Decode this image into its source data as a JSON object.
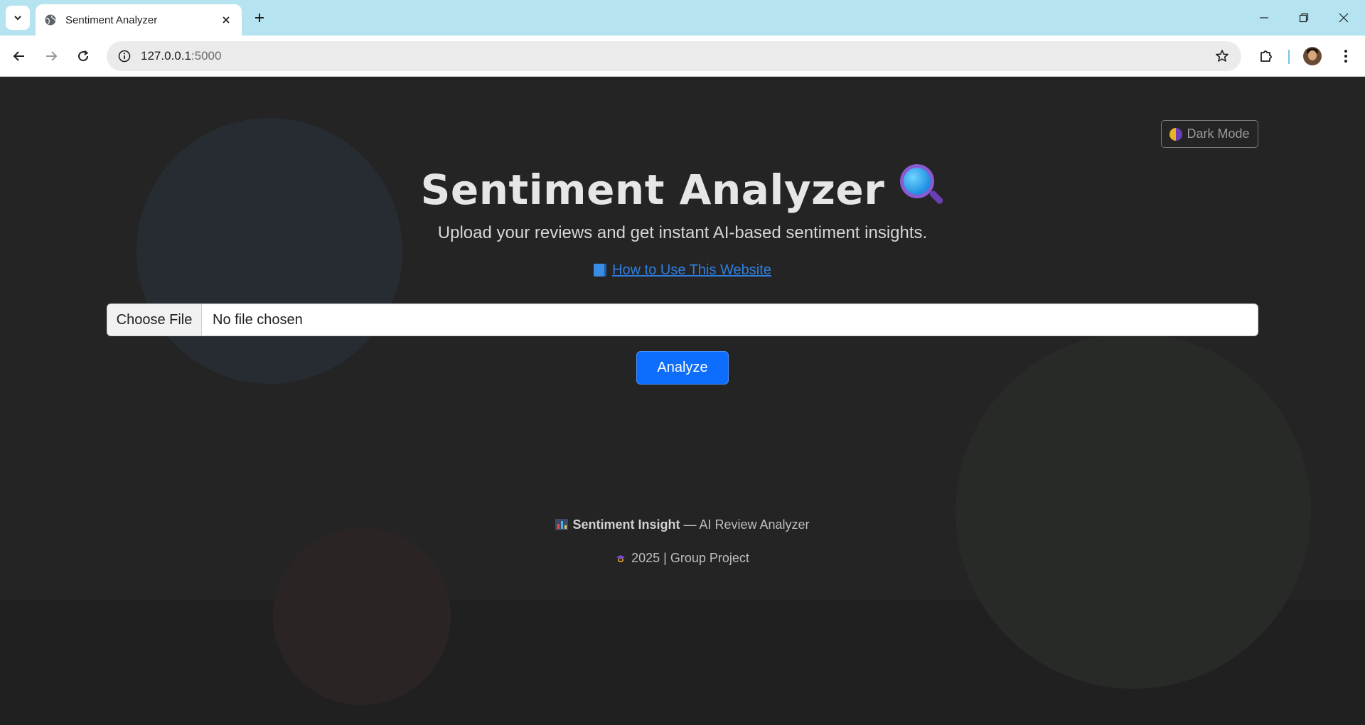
{
  "browser": {
    "tab_title": "Sentiment Analyzer",
    "url_host": "127.0.0.1",
    "url_port": ":5000"
  },
  "page": {
    "theme_toggle_label": "Dark Mode",
    "title": "Sentiment Analyzer",
    "subtitle": "Upload your reviews and get instant AI-based sentiment insights.",
    "how_to_link": "How to Use This Website",
    "file_input": {
      "button_label": "Choose File",
      "status": "No file chosen"
    },
    "analyze_button": "Analyze",
    "footer": {
      "brand": "Sentiment Insight",
      "tagline": "— AI Review Analyzer",
      "credit": "2025 | Group Project"
    },
    "colors": {
      "primary": "#0d6efd",
      "link": "#2f7fe0",
      "background": "#242424"
    }
  }
}
